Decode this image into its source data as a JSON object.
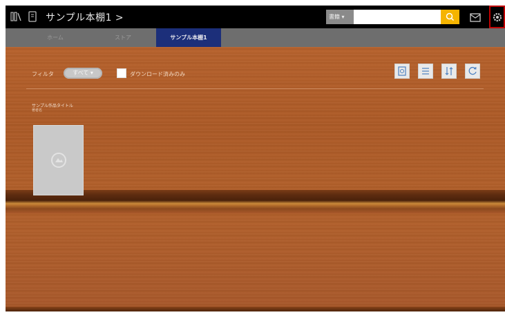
{
  "header": {
    "title": "サンプル本棚1 >",
    "search_select": "書籍 ▾",
    "search_value": ""
  },
  "tabs": [
    {
      "label": "ホーム"
    },
    {
      "label": "ストア"
    },
    {
      "label": "サンプル本棚1"
    }
  ],
  "toolbar": {
    "filter_label": "フィルタ",
    "filter_value": "すべて ▾",
    "checkbox_label": "ダウンロード済みのみ"
  },
  "book": {
    "title": "サンプル作品タイトル",
    "subtitle": "著者名"
  },
  "colors": {
    "active_tab": "#1c2f7a",
    "search_button": "#f5b400",
    "topbar": "#000000"
  }
}
